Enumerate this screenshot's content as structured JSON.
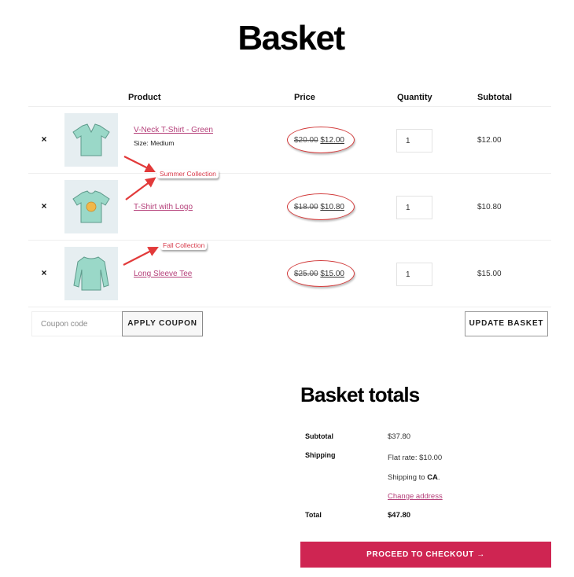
{
  "page": {
    "title": "Basket"
  },
  "table": {
    "headers": {
      "product": "Product",
      "price": "Price",
      "quantity": "Quantity",
      "subtotal": "Subtotal"
    },
    "rows": [
      {
        "remove": "×",
        "name": "V-Neck T-Shirt - Green",
        "meta": "Size: Medium",
        "regular_price": "$20.00",
        "sale_price": "$12.00",
        "quantity": "1",
        "subtotal": "$12.00",
        "image": "green-vneck-tshirt"
      },
      {
        "remove": "×",
        "name": "T-Shirt with Logo",
        "meta": "",
        "regular_price": "$18.00",
        "sale_price": "$10.80",
        "quantity": "1",
        "subtotal": "$10.80",
        "image": "tshirt-with-logo"
      },
      {
        "remove": "×",
        "name": "Long Sleeve Tee",
        "meta": "",
        "regular_price": "$25.00",
        "sale_price": "$15.00",
        "quantity": "1",
        "subtotal": "$15.00",
        "image": "long-sleeve-tee"
      }
    ]
  },
  "annotations": {
    "summer": "Summer Collection",
    "fall": "Fall Collection",
    "color": "#d83a4a"
  },
  "actions": {
    "coupon_placeholder": "Coupon code",
    "apply_coupon": "APPLY COUPON",
    "update_basket": "UPDATE BASKET"
  },
  "totals": {
    "title": "Basket totals",
    "subtotal_label": "Subtotal",
    "subtotal_value": "$37.80",
    "shipping_label": "Shipping",
    "shipping_rate": "Flat rate: $10.00",
    "shipping_to_prefix": "Shipping to ",
    "shipping_to_region": "CA",
    "shipping_to_suffix": ".",
    "change_address": "Change address",
    "total_label": "Total",
    "total_value": "$47.80"
  },
  "checkout": {
    "label": "PROCEED TO CHECKOUT",
    "arrow": "→"
  },
  "colors": {
    "accent": "#cf2552",
    "link": "#b5407a",
    "annotation": "#d23b3b"
  }
}
